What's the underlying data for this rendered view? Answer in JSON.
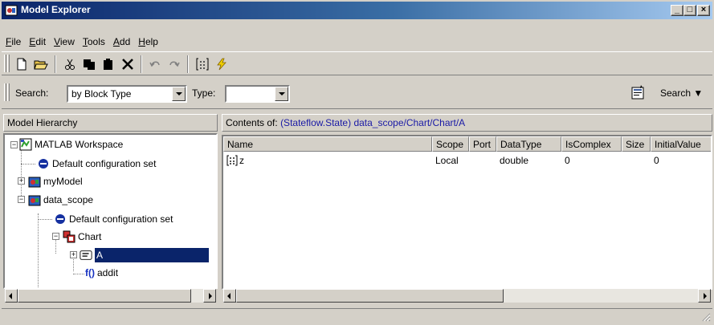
{
  "window": {
    "title": "Model Explorer",
    "controls": [
      "_",
      "□",
      "×"
    ]
  },
  "menu": [
    {
      "label": "File",
      "key": "F"
    },
    {
      "label": "Edit",
      "key": "E"
    },
    {
      "label": "View",
      "key": "V"
    },
    {
      "label": "Tools",
      "key": "T"
    },
    {
      "label": "Add",
      "key": "A"
    },
    {
      "label": "Help",
      "key": "H"
    }
  ],
  "toolbar": {
    "icons": [
      "new-icon",
      "open-icon",
      "cut-icon",
      "copy-icon",
      "paste-icon",
      "delete-icon",
      "undo-icon",
      "redo-icon",
      "data-icon",
      "event-icon"
    ]
  },
  "search": {
    "label": "Search:",
    "by_value": "by Block Type",
    "type_label": "Type:",
    "type_value": "",
    "search_button": "Search"
  },
  "hierarchy": {
    "header": "Model Hierarchy",
    "items": [
      {
        "label": "MATLAB Workspace",
        "icon": "workspace-icon"
      },
      {
        "label": "Default configuration set",
        "icon": "config-icon"
      },
      {
        "label": "myModel",
        "icon": "model-icon"
      },
      {
        "label": "data_scope",
        "icon": "model-icon"
      },
      {
        "label": "Default configuration set",
        "icon": "config-icon"
      },
      {
        "label": "Chart",
        "icon": "chart-icon"
      },
      {
        "label": "A",
        "icon": "state-icon"
      },
      {
        "label": "addit",
        "icon": "function-icon",
        "prefix": "f()"
      }
    ]
  },
  "contents": {
    "prefix": "Contents of:",
    "link": "(Stateflow.State) data_scope/Chart/Chart/A",
    "columns": [
      "Name",
      "Scope",
      "Port",
      "DataType",
      "IsComplex",
      "Size",
      "InitialValue"
    ],
    "rows": [
      {
        "name": "z",
        "scope": "Local",
        "port": "",
        "datatype": "double",
        "iscomplex": "0",
        "size": "",
        "initialvalue": "0"
      }
    ]
  },
  "colors": {
    "titlebar": "#0a246a",
    "selection": "#0a246a",
    "link": "#1a1aa6"
  }
}
